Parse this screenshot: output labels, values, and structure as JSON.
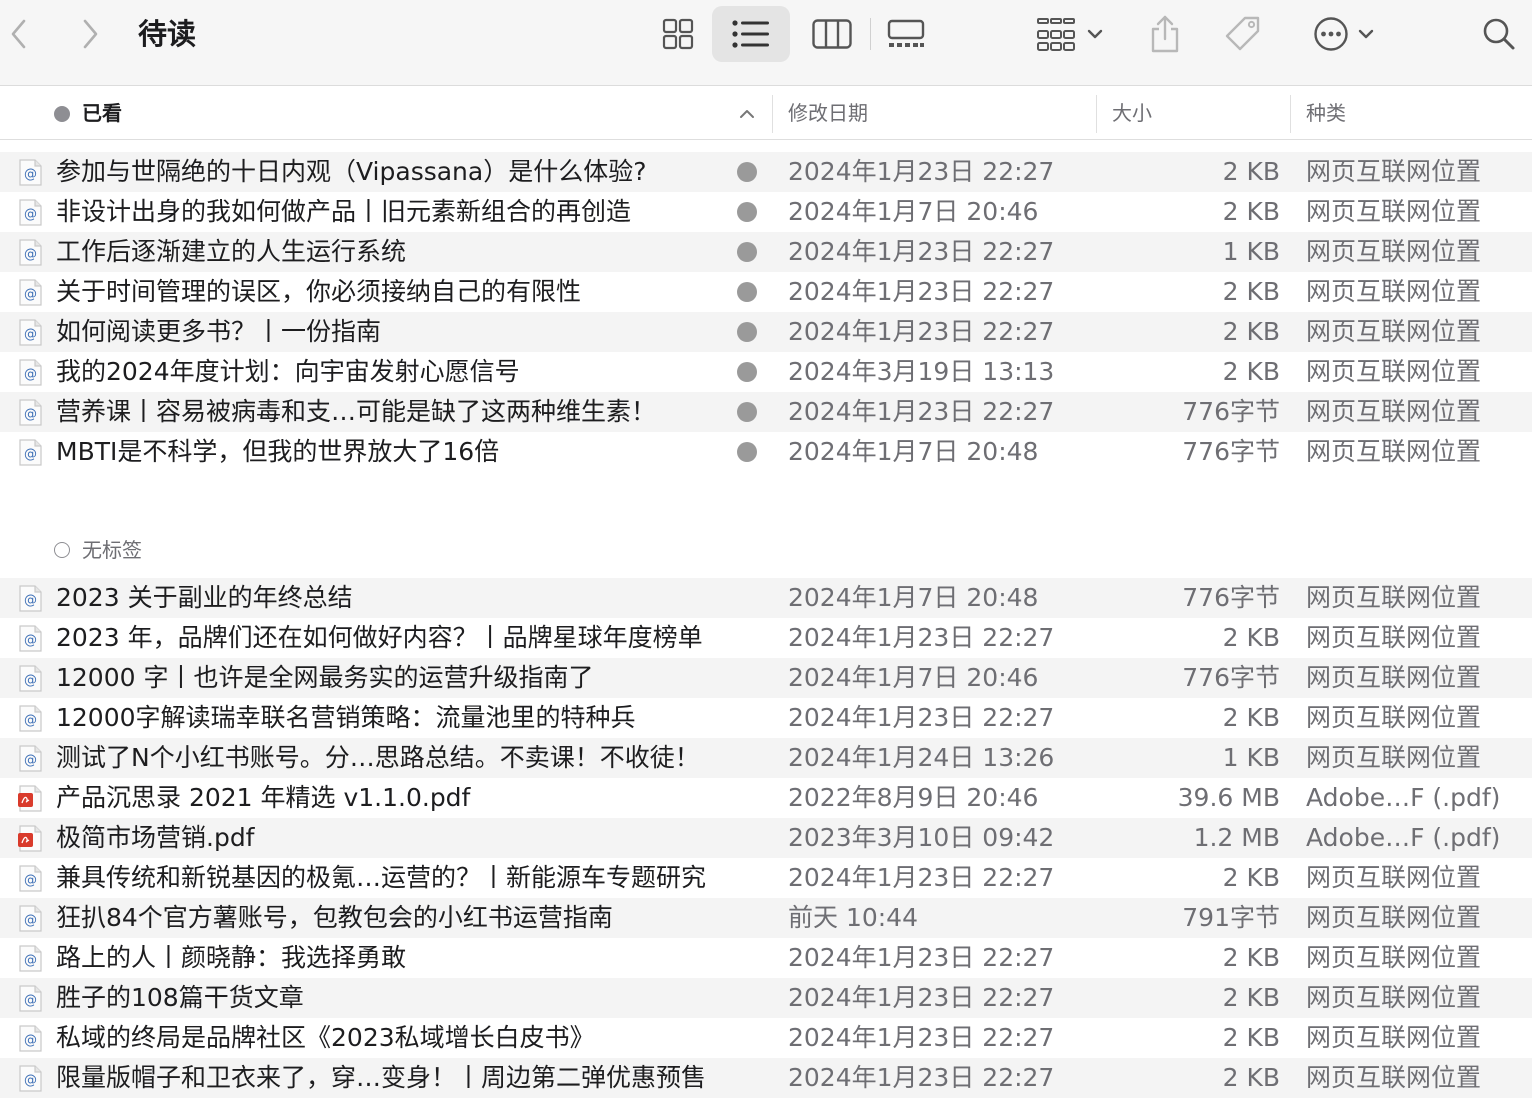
{
  "window": {
    "title": "待读"
  },
  "columns": {
    "name": "已看",
    "date": "修改日期",
    "size": "大小",
    "kind": "种类"
  },
  "groups": [
    {
      "label": "已看",
      "tag": "filled",
      "rows": [
        {
          "name": "参加与世隔绝的十日内观（Vipassana）是什么体验?",
          "date": "2024年1月23日 22:27",
          "size": "2 KB",
          "kind": "网页互联网位置",
          "icon": "webloc",
          "tag": true
        },
        {
          "name": "非设计出身的我如何做产品丨旧元素新组合的再创造",
          "date": "2024年1月7日 20:46",
          "size": "2 KB",
          "kind": "网页互联网位置",
          "icon": "webloc",
          "tag": true
        },
        {
          "name": "工作后逐渐建立的人生运行系统",
          "date": "2024年1月23日 22:27",
          "size": "1 KB",
          "kind": "网页互联网位置",
          "icon": "webloc",
          "tag": true
        },
        {
          "name": "关于时间管理的误区，你必须接纳自己的有限性",
          "date": "2024年1月23日 22:27",
          "size": "2 KB",
          "kind": "网页互联网位置",
          "icon": "webloc",
          "tag": true
        },
        {
          "name": "如何阅读更多书？丨一份指南",
          "date": "2024年1月23日 22:27",
          "size": "2 KB",
          "kind": "网页互联网位置",
          "icon": "webloc",
          "tag": true
        },
        {
          "name": "我的2024年度计划：向宇宙发射心愿信号",
          "date": "2024年3月19日 13:13",
          "size": "2 KB",
          "kind": "网页互联网位置",
          "icon": "webloc",
          "tag": true
        },
        {
          "name": "营养课丨容易被病毒和支…可能是缺了这两种维生素！",
          "date": "2024年1月23日 22:27",
          "size": "776字节",
          "kind": "网页互联网位置",
          "icon": "webloc",
          "tag": true
        },
        {
          "name": "MBTI是不科学，但我的世界放大了16倍",
          "date": "2024年1月7日 20:48",
          "size": "776字节",
          "kind": "网页互联网位置",
          "icon": "webloc",
          "tag": true
        }
      ]
    },
    {
      "label": "无标签",
      "tag": "empty",
      "rows": [
        {
          "name": "2023 关于副业的年终总结",
          "date": "2024年1月7日 20:48",
          "size": "776字节",
          "kind": "网页互联网位置",
          "icon": "webloc",
          "tag": false
        },
        {
          "name": "2023 年，品牌们还在如何做好内容？丨品牌星球年度榜单",
          "date": "2024年1月23日 22:27",
          "size": "2 KB",
          "kind": "网页互联网位置",
          "icon": "webloc",
          "tag": false
        },
        {
          "name": "12000 字丨也许是全网最务实的运营升级指南了",
          "date": "2024年1月7日 20:46",
          "size": "776字节",
          "kind": "网页互联网位置",
          "icon": "webloc",
          "tag": false
        },
        {
          "name": "12000字解读瑞幸联名营销策略：流量池里的特种兵",
          "date": "2024年1月23日 22:27",
          "size": "2 KB",
          "kind": "网页互联网位置",
          "icon": "webloc",
          "tag": false
        },
        {
          "name": "测试了N个小红书账号。分…思路总结。不卖课！不收徒！",
          "date": "2024年1月24日 13:26",
          "size": "1 KB",
          "kind": "网页互联网位置",
          "icon": "webloc",
          "tag": false
        },
        {
          "name": "产品沉思录 2021 年精选 v1.1.0.pdf",
          "date": "2022年8月9日 20:46",
          "size": "39.6 MB",
          "kind": "Adobe…F (.pdf)",
          "icon": "pdf",
          "tag": false
        },
        {
          "name": "极简市场营销.pdf",
          "date": "2023年3月10日 09:42",
          "size": "1.2 MB",
          "kind": "Adobe…F (.pdf)",
          "icon": "pdf",
          "tag": false
        },
        {
          "name": "兼具传统和新锐基因的极氪…运营的？丨新能源车专题研究",
          "date": "2024年1月23日 22:27",
          "size": "2 KB",
          "kind": "网页互联网位置",
          "icon": "webloc",
          "tag": false
        },
        {
          "name": "狂扒84个官方薯账号，包教包会的小红书运营指南",
          "date": "前天 10:44",
          "size": "791字节",
          "kind": "网页互联网位置",
          "icon": "webloc",
          "tag": false
        },
        {
          "name": "路上的人丨颜晓静：我选择勇敢",
          "date": "2024年1月23日 22:27",
          "size": "2 KB",
          "kind": "网页互联网位置",
          "icon": "webloc",
          "tag": false
        },
        {
          "name": "胜子的108篇干货文章",
          "date": "2024年1月23日 22:27",
          "size": "2 KB",
          "kind": "网页互联网位置",
          "icon": "webloc",
          "tag": false
        },
        {
          "name": "私域的终局是品牌社区《2023私域增长白皮书》",
          "date": "2024年1月23日 22:27",
          "size": "2 KB",
          "kind": "网页互联网位置",
          "icon": "webloc",
          "tag": false
        },
        {
          "name": "限量版帽子和卫衣来了，穿…变身！丨周边第二弹优惠预售",
          "date": "2024年1月23日 22:27",
          "size": "2 KB",
          "kind": "网页互联网位置",
          "icon": "webloc",
          "tag": false
        }
      ]
    }
  ],
  "icons": {
    "back": "chevron-left-icon",
    "forward": "chevron-right-icon",
    "icon_view": "grid-icon",
    "list_view": "list-icon",
    "column_view": "columns-icon",
    "gallery_view": "gallery-icon",
    "group": "group-icon",
    "share": "share-icon",
    "tag": "tag-icon",
    "more": "ellipsis-circle-icon",
    "search": "search-icon"
  },
  "colors": {
    "tag_gray": "#9a9a9a",
    "pdf_red": "#d93a2b",
    "row_alt": "#f4f4f4"
  }
}
